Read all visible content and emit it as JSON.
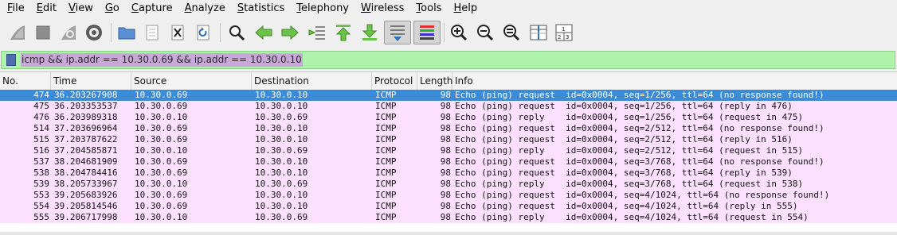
{
  "menu": [
    {
      "first": "F",
      "rest": "ile"
    },
    {
      "first": "E",
      "rest": "dit"
    },
    {
      "first": "V",
      "rest": "iew"
    },
    {
      "first": "G",
      "rest": "o"
    },
    {
      "first": "C",
      "rest": "apture"
    },
    {
      "first": "A",
      "rest": "nalyze"
    },
    {
      "first": "S",
      "rest": "tatistics"
    },
    {
      "first": "T",
      "rest": "elephony"
    },
    {
      "first": "W",
      "rest": "ireless"
    },
    {
      "first": "T",
      "rest": "ools"
    },
    {
      "first": "H",
      "rest": "elp"
    }
  ],
  "toolbar_icons": [
    "shark-fin-start-icon",
    "stop-square-icon",
    "restart-fin-icon",
    "capture-options-gear-icon",
    "open-folder-icon",
    "file-icon",
    "close-file-icon",
    "reload-icon",
    "find-magnifier-icon",
    "go-back-arrow-icon",
    "go-forward-arrow-icon",
    "go-to-packet-icon",
    "go-first-arrow-icon",
    "go-last-arrow-icon",
    "autoscroll-icon",
    "colorize-icon",
    "zoom-in-icon",
    "zoom-out-icon",
    "zoom-normal-icon",
    "resize-columns-icon",
    "layout-icon"
  ],
  "filter": {
    "text": "icmp && ip.addr == 10.30.0.69 && ip.addr == 10.30.0.10"
  },
  "columns": [
    "No.",
    "Time",
    "Source",
    "Destination",
    "Protocol",
    "Length",
    "Info"
  ],
  "rows": [
    {
      "no": "474",
      "time": "36.203267908",
      "src": "10.30.0.69",
      "dst": "10.30.0.10",
      "proto": "ICMP",
      "len": "98",
      "info": "Echo (ping) request  id=0x0004, seq=1/256, ttl=64 (no response found!)",
      "selected": true
    },
    {
      "no": "475",
      "time": "36.203353537",
      "src": "10.30.0.69",
      "dst": "10.30.0.10",
      "proto": "ICMP",
      "len": "98",
      "info": "Echo (ping) request  id=0x0004, seq=1/256, ttl=64 (reply in 476)",
      "selected": false
    },
    {
      "no": "476",
      "time": "36.203989318",
      "src": "10.30.0.10",
      "dst": "10.30.0.69",
      "proto": "ICMP",
      "len": "98",
      "info": "Echo (ping) reply    id=0x0004, seq=1/256, ttl=64 (request in 475)",
      "selected": false
    },
    {
      "no": "514",
      "time": "37.203696964",
      "src": "10.30.0.69",
      "dst": "10.30.0.10",
      "proto": "ICMP",
      "len": "98",
      "info": "Echo (ping) request  id=0x0004, seq=2/512, ttl=64 (no response found!)",
      "selected": false
    },
    {
      "no": "515",
      "time": "37.203787622",
      "src": "10.30.0.69",
      "dst": "10.30.0.10",
      "proto": "ICMP",
      "len": "98",
      "info": "Echo (ping) request  id=0x0004, seq=2/512, ttl=64 (reply in 516)",
      "selected": false
    },
    {
      "no": "516",
      "time": "37.204585871",
      "src": "10.30.0.10",
      "dst": "10.30.0.69",
      "proto": "ICMP",
      "len": "98",
      "info": "Echo (ping) reply    id=0x0004, seq=2/512, ttl=64 (request in 515)",
      "selected": false
    },
    {
      "no": "537",
      "time": "38.204681909",
      "src": "10.30.0.69",
      "dst": "10.30.0.10",
      "proto": "ICMP",
      "len": "98",
      "info": "Echo (ping) request  id=0x0004, seq=3/768, ttl=64 (no response found!)",
      "selected": false
    },
    {
      "no": "538",
      "time": "38.204784416",
      "src": "10.30.0.69",
      "dst": "10.30.0.10",
      "proto": "ICMP",
      "len": "98",
      "info": "Echo (ping) request  id=0x0004, seq=3/768, ttl=64 (reply in 539)",
      "selected": false
    },
    {
      "no": "539",
      "time": "38.205733967",
      "src": "10.30.0.10",
      "dst": "10.30.0.69",
      "proto": "ICMP",
      "len": "98",
      "info": "Echo (ping) reply    id=0x0004, seq=3/768, ttl=64 (request in 538)",
      "selected": false
    },
    {
      "no": "553",
      "time": "39.205683926",
      "src": "10.30.0.69",
      "dst": "10.30.0.10",
      "proto": "ICMP",
      "len": "98",
      "info": "Echo (ping) request  id=0x0004, seq=4/1024, ttl=64 (no response found!)",
      "selected": false
    },
    {
      "no": "554",
      "time": "39.205814546",
      "src": "10.30.0.69",
      "dst": "10.30.0.10",
      "proto": "ICMP",
      "len": "98",
      "info": "Echo (ping) request  id=0x0004, seq=4/1024, ttl=64 (reply in 555)",
      "selected": false
    },
    {
      "no": "555",
      "time": "39.206717998",
      "src": "10.30.0.10",
      "dst": "10.30.0.69",
      "proto": "ICMP",
      "len": "98",
      "info": "Echo (ping) reply    id=0x0004, seq=4/1024, ttl=64 (request in 554)",
      "selected": false
    }
  ],
  "colors": {
    "filter_bg": "#aff2ac",
    "row_bg": "#fde0ff",
    "selected_bg": "#3b8bd6",
    "filter_text_highlight": "#c9a7d8"
  }
}
